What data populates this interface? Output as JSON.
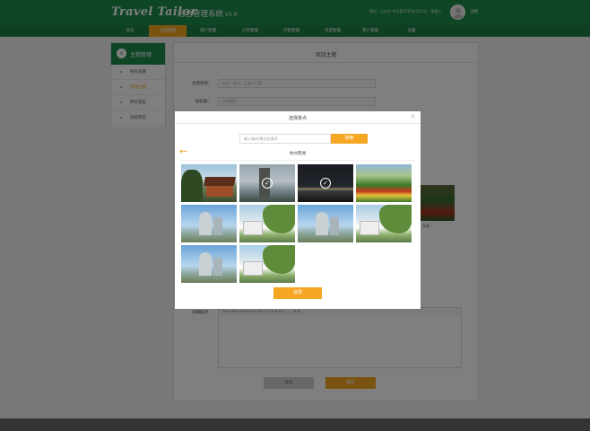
{
  "header": {
    "brand": "Travel Tailor",
    "subtitle": "后台管理系统",
    "version": "V1.0",
    "greeting": "您好，王先生  今天是2015年5月1日，星期三",
    "logout": "注销"
  },
  "nav": [
    "首页",
    "主题管理",
    "用户管理",
    "订单管理",
    "行程管理",
    "导游管理",
    "客户管理",
    "设置"
  ],
  "sidebar": {
    "title": "主题管理",
    "items": [
      "所有主题",
      "添加主题",
      "所有景区",
      "添加景区"
    ]
  },
  "main": {
    "title": "添加主题",
    "theme_name_label": "主题名称:",
    "theme_name_placeholder": "杭州、苏州、上海三日游",
    "sub_title_label": "副标题:",
    "sub_title_placeholder": "西湖景区",
    "detail_label": "详细描述:",
    "editor_toolbar": "Times New Roman ▾  4 ▾  B I U A ≡ ≡ ≡ ≡ ⋮ ⋮ ⊞ ⊞",
    "bg_caption": "西湖",
    "cancel": "取消",
    "confirm": "确定"
  },
  "modal": {
    "title": "选择景点",
    "search_placeholder": "输入城市/景点关键词",
    "search_button": "搜索",
    "group": "杭州西湖",
    "select_button": "选择",
    "thumbs": [
      {
        "name": "temple",
        "selected": false
      },
      {
        "name": "pagoda",
        "selected": true
      },
      {
        "name": "night",
        "selected": true
      },
      {
        "name": "garden",
        "selected": false
      },
      {
        "name": "bridge",
        "selected": false
      },
      {
        "name": "willow",
        "selected": false
      },
      {
        "name": "bridge",
        "selected": false
      },
      {
        "name": "willow",
        "selected": false
      },
      {
        "name": "bridge",
        "selected": false
      },
      {
        "name": "willow",
        "selected": false
      }
    ]
  },
  "colors": {
    "brand_green": "#1c8a4a",
    "accent_orange": "#f5a623"
  }
}
